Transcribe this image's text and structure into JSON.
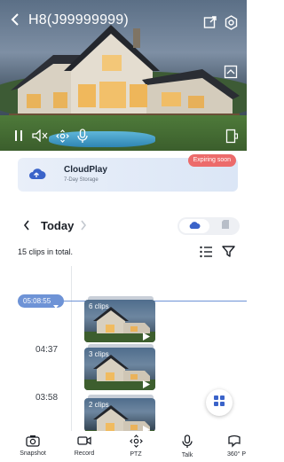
{
  "header": {
    "title": "H8(J99999999)",
    "icons": [
      "back-icon",
      "share-icon",
      "settings-icon"
    ]
  },
  "video_controls": {
    "icons": [
      "pause-icon",
      "mute-icon",
      "ptz-icon",
      "mic-icon",
      "fullscreen-icon",
      "screenshot-preview-icon"
    ]
  },
  "cloud": {
    "name": "CloudPlay",
    "subtitle": "7-Day Storage",
    "badge": "Expiring soon",
    "badge_color": "#ec6b6b",
    "brand_color": "#3a63c9"
  },
  "date_nav": {
    "date": "Today",
    "storage_tabs": [
      "cloud-icon",
      "sd-card-icon"
    ],
    "selected_tab": "cloud-icon"
  },
  "summary": {
    "clips_total": "15 clips in total."
  },
  "timeline": {
    "current_time": "05:08:55",
    "times": [
      "04:37",
      "03:58"
    ],
    "accent_color": "#6e93d6",
    "groups": [
      {
        "label": "6 clips"
      },
      {
        "label": "3 clips"
      },
      {
        "label": "2 clips"
      }
    ]
  },
  "toolbar": {
    "items": [
      {
        "label": "Snapshot",
        "icon": "camera-icon"
      },
      {
        "label": "Record",
        "icon": "video-record-icon"
      },
      {
        "label": "PTZ",
        "icon": "ptz-icon"
      },
      {
        "label": "Talk",
        "icon": "mic-icon"
      },
      {
        "label": "360° P",
        "icon": "panorama-icon"
      }
    ]
  }
}
